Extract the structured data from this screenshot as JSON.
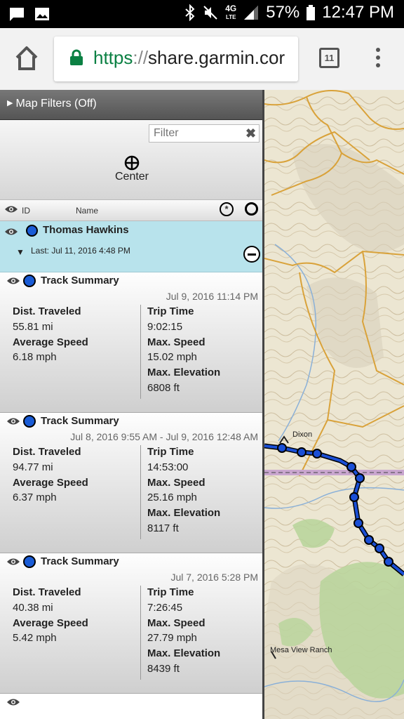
{
  "status_bar": {
    "network": "4G",
    "network_sub": "LTE",
    "battery": "57%",
    "time": "12:47 PM"
  },
  "browser": {
    "url_scheme": "https",
    "url_sep": "://",
    "url_host": "share.garmin.cor",
    "tab_count": "11"
  },
  "sidebar": {
    "filters_label": "Map Filters (Off)",
    "filter_placeholder": "Filter",
    "filter_clear": "✖",
    "center_label": "Center",
    "header": {
      "id": "ID",
      "name": "Name"
    },
    "user": {
      "name": "Thomas Hawkins",
      "last": "Last: Jul 11, 2016 4:48 PM"
    },
    "tracks": [
      {
        "title": "Track Summary",
        "date": "Jul 9, 2016 11:14 PM",
        "dist_label": "Dist. Traveled",
        "dist": "55.81 mi",
        "avg_label": "Average Speed",
        "avg": "6.18 mph",
        "trip_label": "Trip Time",
        "trip": "9:02:15",
        "max_label": "Max. Speed",
        "max": "15.02 mph",
        "elev_label": "Max. Elevation",
        "elev": "6808 ft"
      },
      {
        "title": "Track Summary",
        "date": "Jul 8, 2016 9:55 AM - Jul 9, 2016 12:48 AM",
        "dist_label": "Dist. Traveled",
        "dist": "94.77 mi",
        "avg_label": "Average Speed",
        "avg": "6.37 mph",
        "trip_label": "Trip Time",
        "trip": "14:53:00",
        "max_label": "Max. Speed",
        "max": "25.16 mph",
        "elev_label": "Max. Elevation",
        "elev": "8117 ft"
      },
      {
        "title": "Track Summary",
        "date": "Jul 7, 2016 5:28 PM",
        "dist_label": "Dist. Traveled",
        "dist": "40.38 mi",
        "avg_label": "Average Speed",
        "avg": "5.42 mph",
        "trip_label": "Trip Time",
        "trip": "7:26:45",
        "max_label": "Max. Speed",
        "max": "27.79 mph",
        "elev_label": "Max. Elevation",
        "elev": "8439 ft"
      }
    ]
  },
  "map": {
    "labels": {
      "dixon": "Dixon",
      "mesa": "Mesa View Ranch"
    },
    "colors": {
      "route": "#1a4fd6",
      "road": "#d9a23a",
      "water": "#8ab0d8",
      "vegetation": "#b7d49a"
    }
  }
}
